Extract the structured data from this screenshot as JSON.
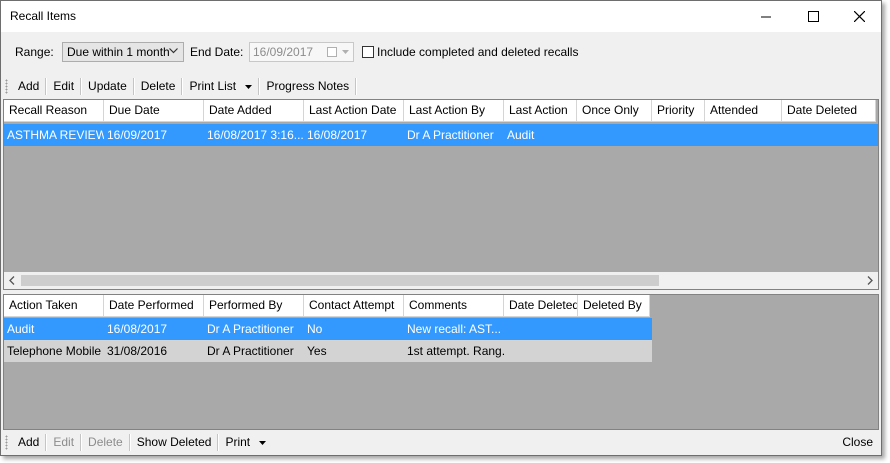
{
  "window": {
    "title": "Recall Items"
  },
  "filters": {
    "range_label": "Range:",
    "range_value": "Due within 1 month",
    "end_date_label": "End Date:",
    "end_date_value": "16/09/2017",
    "include_label": "Include completed and deleted recalls",
    "include_checked": false
  },
  "top_toolbar": {
    "add": "Add",
    "edit": "Edit",
    "update": "Update",
    "delete": "Delete",
    "print_list": "Print List",
    "progress_notes": "Progress Notes"
  },
  "recalls_table": {
    "columns": [
      "Recall Reason",
      "Due Date",
      "Date Added",
      "Last Action Date",
      "Last Action By",
      "Last Action",
      "Once Only",
      "Priority",
      "Attended",
      "Date Deleted"
    ],
    "rows": [
      [
        "ASTHMA REVIEW",
        "16/09/2017",
        "16/08/2017 3:16...",
        "16/08/2017",
        "Dr A Practitioner",
        "Audit",
        "",
        "",
        "",
        ""
      ]
    ]
  },
  "actions_table": {
    "columns": [
      "Action Taken",
      "Date Performed",
      "Performed By",
      "Contact Attempt",
      "Comments",
      "Date Deleted",
      "Deleted By"
    ],
    "rows": [
      [
        "Audit",
        "16/08/2017",
        "Dr A Practitioner",
        "No",
        "New recall: AST...",
        "",
        ""
      ],
      [
        "Telephone Mobile",
        "31/08/2016",
        "Dr A Practitioner",
        "Yes",
        "1st attempt. Rang...",
        "",
        ""
      ]
    ]
  },
  "bottom_toolbar": {
    "add": "Add",
    "edit": "Edit",
    "delete": "Delete",
    "show_deleted": "Show Deleted",
    "print": "Print",
    "close": "Close"
  },
  "colors": {
    "selection": "#3399ff",
    "grid_background": "#a9a9a9",
    "alt_row": "#d3d3d3"
  }
}
